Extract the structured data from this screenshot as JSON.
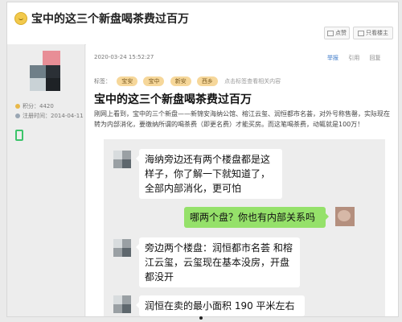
{
  "header": {
    "title": "宝中的这三个新盘喝茶费过百万",
    "btn_favorite": "点赞",
    "btn_share": "只看楼主"
  },
  "sidebar": {
    "points_label": "积分：4420",
    "register_label": "注册时间：2014-04-11"
  },
  "post": {
    "date": "2020-03-24 15:52:27",
    "actions": [
      "举报",
      "引用",
      "回复"
    ],
    "tags_label": "标签：",
    "tags": [
      "宝安",
      "宝中",
      "新安",
      "西乡"
    ],
    "tags_hint": "点击标签查看相关内容",
    "title": "宝中的这三个新盘喝茶费过百万",
    "body": "刚网上看到，宝中的三个新盘——新锦安海纳公馆、榕江云玺、润恒都市名荟，对外号称售罄，实际现在转为内部消化，要缴纳所谓的喝茶费（即更名费）才能买房。而这笔喝茶费，动辄就是100万！"
  },
  "chat": {
    "messages": [
      {
        "side": "left",
        "text": "海纳旁边还有两个楼盘都是这样子，你了解一下就知道了，全部内部消化，更可怕"
      },
      {
        "side": "right",
        "text": "哪两个盘？你也有内部关系吗"
      },
      {
        "side": "left",
        "text": "旁边两个楼盘：润恒都市名荟 和榕江云玺，云玺现在基本没房，开盘都没开"
      },
      {
        "side": "left",
        "text": "润恒在卖的最小面积 190 平米左右"
      }
    ]
  },
  "colors": {
    "green_bubble": "#95e16a",
    "tag_bg": "#f6d79a",
    "link_blue": "#3a78c8"
  }
}
